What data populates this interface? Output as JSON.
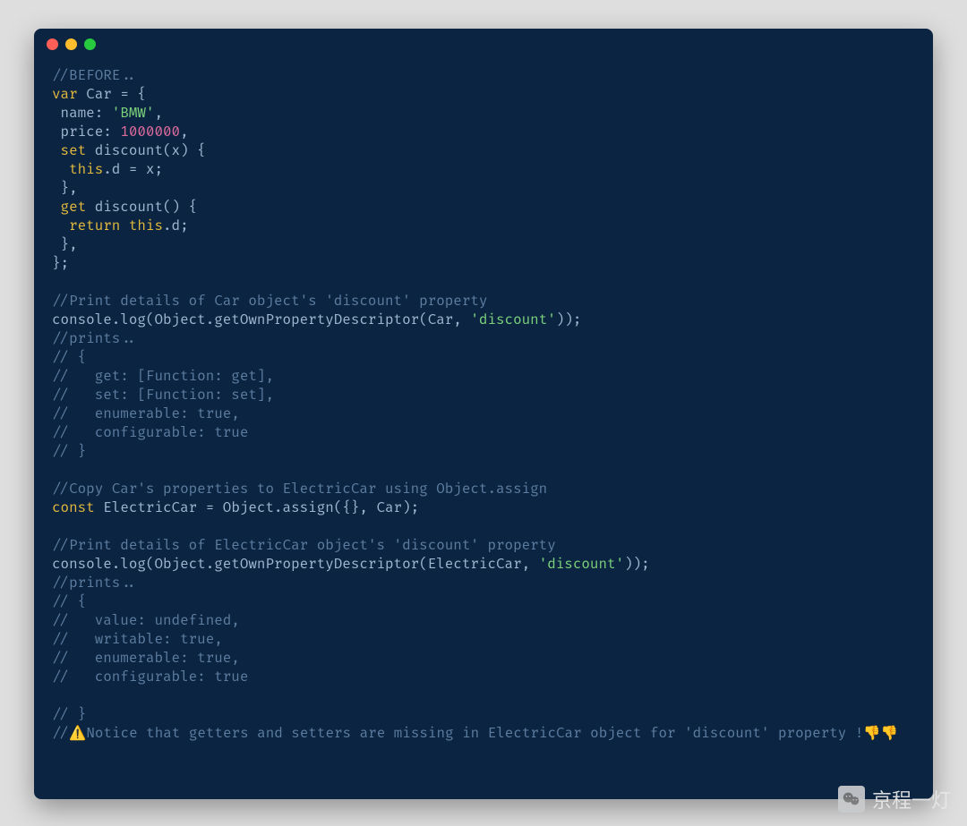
{
  "watermark": {
    "text": "京程一灯"
  },
  "code": {
    "lines": [
      {
        "segs": [
          {
            "t": "//BEFORE..",
            "c": "comment"
          }
        ]
      },
      {
        "segs": [
          {
            "t": "var",
            "c": "keyword"
          },
          {
            "t": " Car = {",
            "c": "text"
          }
        ]
      },
      {
        "segs": [
          {
            "t": " name: ",
            "c": "text"
          },
          {
            "t": "'BMW'",
            "c": "string"
          },
          {
            "t": ",",
            "c": "text"
          }
        ]
      },
      {
        "segs": [
          {
            "t": " price: ",
            "c": "text"
          },
          {
            "t": "1000000",
            "c": "number"
          },
          {
            "t": ",",
            "c": "text"
          }
        ]
      },
      {
        "segs": [
          {
            "t": " set",
            "c": "keyword"
          },
          {
            "t": " discount(x) {",
            "c": "text"
          }
        ]
      },
      {
        "segs": [
          {
            "t": "  ",
            "c": "text"
          },
          {
            "t": "this",
            "c": "this"
          },
          {
            "t": ".d = x;",
            "c": "text"
          }
        ]
      },
      {
        "segs": [
          {
            "t": " },",
            "c": "text"
          }
        ]
      },
      {
        "segs": [
          {
            "t": " get",
            "c": "keyword"
          },
          {
            "t": " discount() {",
            "c": "text"
          }
        ]
      },
      {
        "segs": [
          {
            "t": "  ",
            "c": "text"
          },
          {
            "t": "return",
            "c": "keyword"
          },
          {
            "t": " ",
            "c": "text"
          },
          {
            "t": "this",
            "c": "this"
          },
          {
            "t": ".d;",
            "c": "text"
          }
        ]
      },
      {
        "segs": [
          {
            "t": " },",
            "c": "text"
          }
        ]
      },
      {
        "segs": [
          {
            "t": "};",
            "c": "text"
          }
        ]
      },
      {
        "segs": [
          {
            "t": "",
            "c": "text"
          }
        ]
      },
      {
        "segs": [
          {
            "t": "//Print details of Car object's 'discount' property",
            "c": "comment"
          }
        ]
      },
      {
        "segs": [
          {
            "t": "console.log(Object.getOwnPropertyDescriptor(Car, ",
            "c": "text"
          },
          {
            "t": "'discount'",
            "c": "string"
          },
          {
            "t": "));",
            "c": "text"
          }
        ]
      },
      {
        "segs": [
          {
            "t": "//prints..",
            "c": "comment"
          }
        ]
      },
      {
        "segs": [
          {
            "t": "// {",
            "c": "comment"
          }
        ]
      },
      {
        "segs": [
          {
            "t": "//   get: [Function: get],",
            "c": "comment"
          }
        ]
      },
      {
        "segs": [
          {
            "t": "//   set: [Function: set],",
            "c": "comment"
          }
        ]
      },
      {
        "segs": [
          {
            "t": "//   enumerable: true,",
            "c": "comment"
          }
        ]
      },
      {
        "segs": [
          {
            "t": "//   configurable: true",
            "c": "comment"
          }
        ]
      },
      {
        "segs": [
          {
            "t": "// }",
            "c": "comment"
          }
        ]
      },
      {
        "segs": [
          {
            "t": "",
            "c": "text"
          }
        ]
      },
      {
        "segs": [
          {
            "t": "//Copy Car's properties to ElectricCar using Object.assign",
            "c": "comment"
          }
        ]
      },
      {
        "segs": [
          {
            "t": "const",
            "c": "const"
          },
          {
            "t": " ElectricCar = Object.assign({}, Car);",
            "c": "text"
          }
        ]
      },
      {
        "segs": [
          {
            "t": "",
            "c": "text"
          }
        ]
      },
      {
        "segs": [
          {
            "t": "//Print details of ElectricCar object's 'discount' property",
            "c": "comment"
          }
        ]
      },
      {
        "segs": [
          {
            "t": "console.log(Object.getOwnPropertyDescriptor(ElectricCar, ",
            "c": "text"
          },
          {
            "t": "'discount'",
            "c": "string"
          },
          {
            "t": "));",
            "c": "text"
          }
        ]
      },
      {
        "segs": [
          {
            "t": "//prints..",
            "c": "comment"
          }
        ]
      },
      {
        "segs": [
          {
            "t": "// {",
            "c": "comment"
          }
        ]
      },
      {
        "segs": [
          {
            "t": "//   value: undefined,",
            "c": "comment"
          }
        ]
      },
      {
        "segs": [
          {
            "t": "//   writable: true,",
            "c": "comment"
          }
        ]
      },
      {
        "segs": [
          {
            "t": "//   enumerable: true,",
            "c": "comment"
          }
        ]
      },
      {
        "segs": [
          {
            "t": "//   configurable: true",
            "c": "comment"
          }
        ]
      },
      {
        "segs": [
          {
            "t": "",
            "c": "text"
          }
        ]
      },
      {
        "segs": [
          {
            "t": "// }",
            "c": "comment"
          }
        ]
      },
      {
        "segs": [
          {
            "t": "//",
            "c": "comment"
          },
          {
            "t": "⚠️",
            "c": "emoji"
          },
          {
            "t": "Notice that getters and setters are missing in ElectricCar object for 'discount' property !",
            "c": "comment"
          },
          {
            "t": "👎👎",
            "c": "emoji"
          }
        ]
      }
    ]
  }
}
